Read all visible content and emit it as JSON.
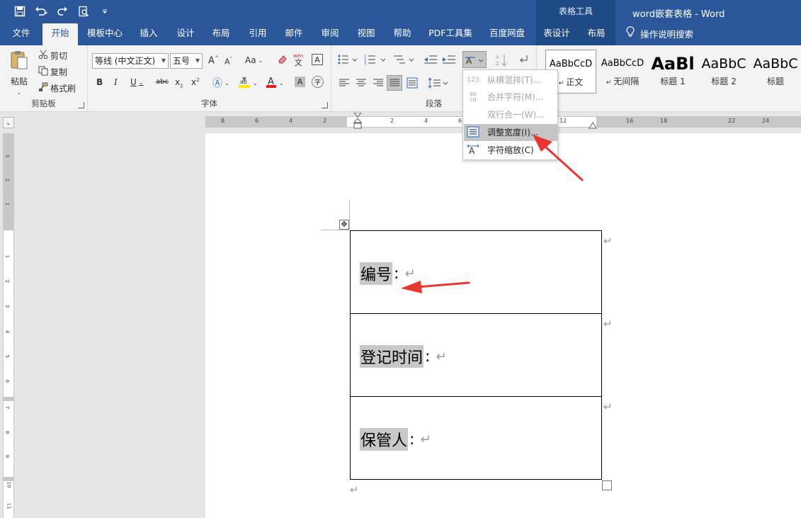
{
  "window": {
    "context_title": "表格工具",
    "doc_title": "word嵌套表格 - Word"
  },
  "tabs": [
    {
      "label": "文件"
    },
    {
      "label": "开始"
    },
    {
      "label": "模板中心"
    },
    {
      "label": "插入"
    },
    {
      "label": "设计"
    },
    {
      "label": "布局"
    },
    {
      "label": "引用"
    },
    {
      "label": "邮件"
    },
    {
      "label": "审阅"
    },
    {
      "label": "视图"
    },
    {
      "label": "帮助"
    },
    {
      "label": "PDF工具集"
    },
    {
      "label": "百度网盘"
    },
    {
      "label": "表设计"
    },
    {
      "label": "布局"
    }
  ],
  "search_label": "操作说明搜索",
  "clipboard": {
    "paste": "粘贴",
    "cut": "剪切",
    "copy": "复制",
    "format_painter": "格式刷",
    "label": "剪贴板"
  },
  "font": {
    "name": "等线 (中文正文)",
    "size": "五号",
    "label": "字体",
    "aa": "Aa",
    "wen": "文",
    "wen_top": "wén",
    "A": "A"
  },
  "paragraph": {
    "label": "段落"
  },
  "styles": [
    {
      "sample": "AaBbCcD",
      "name": "正文"
    },
    {
      "sample": "AaBbCcD",
      "name": "无间隔"
    },
    {
      "sample": "AaBl",
      "name": "标题 1"
    },
    {
      "sample": "AaBbC",
      "name": "标题 2"
    },
    {
      "sample": "AaBbC",
      "name": "标题"
    }
  ],
  "menu": {
    "items": [
      {
        "label": "纵横混排(T)...",
        "icon": "123",
        "disabled": true
      },
      {
        "label": "合并字符(M)...",
        "icon": "ab cd",
        "disabled": true
      },
      {
        "label": "双行合一(W)...",
        "icon": "",
        "disabled": true
      },
      {
        "label": "调整宽度(I)...",
        "icon": "",
        "disabled": false,
        "highlight": true
      },
      {
        "label": "字符缩放(C)",
        "icon": "",
        "disabled": false
      }
    ]
  },
  "ruler": {
    "h_labels": [
      "8",
      "6",
      "4",
      "2",
      "2",
      "4",
      "6",
      "12",
      "16",
      "18",
      "22",
      "24"
    ],
    "v_labels": [
      "3",
      "2",
      "1",
      "1",
      "2",
      "3",
      "4",
      "5",
      "6",
      "7",
      "8",
      "9",
      "10",
      "11"
    ]
  },
  "table": {
    "rows": [
      {
        "label": "编号",
        "colon": ":"
      },
      {
        "label": "登记时间",
        "colon": ":"
      },
      {
        "label": "保管人",
        "colon": ":"
      }
    ]
  },
  "para_mark": "↵",
  "colors": {
    "title_bar": "#2b579a",
    "context_tab": "#1e4a86",
    "annotation_arrow": "#e8372e",
    "highlight": "#c8c8c8"
  }
}
